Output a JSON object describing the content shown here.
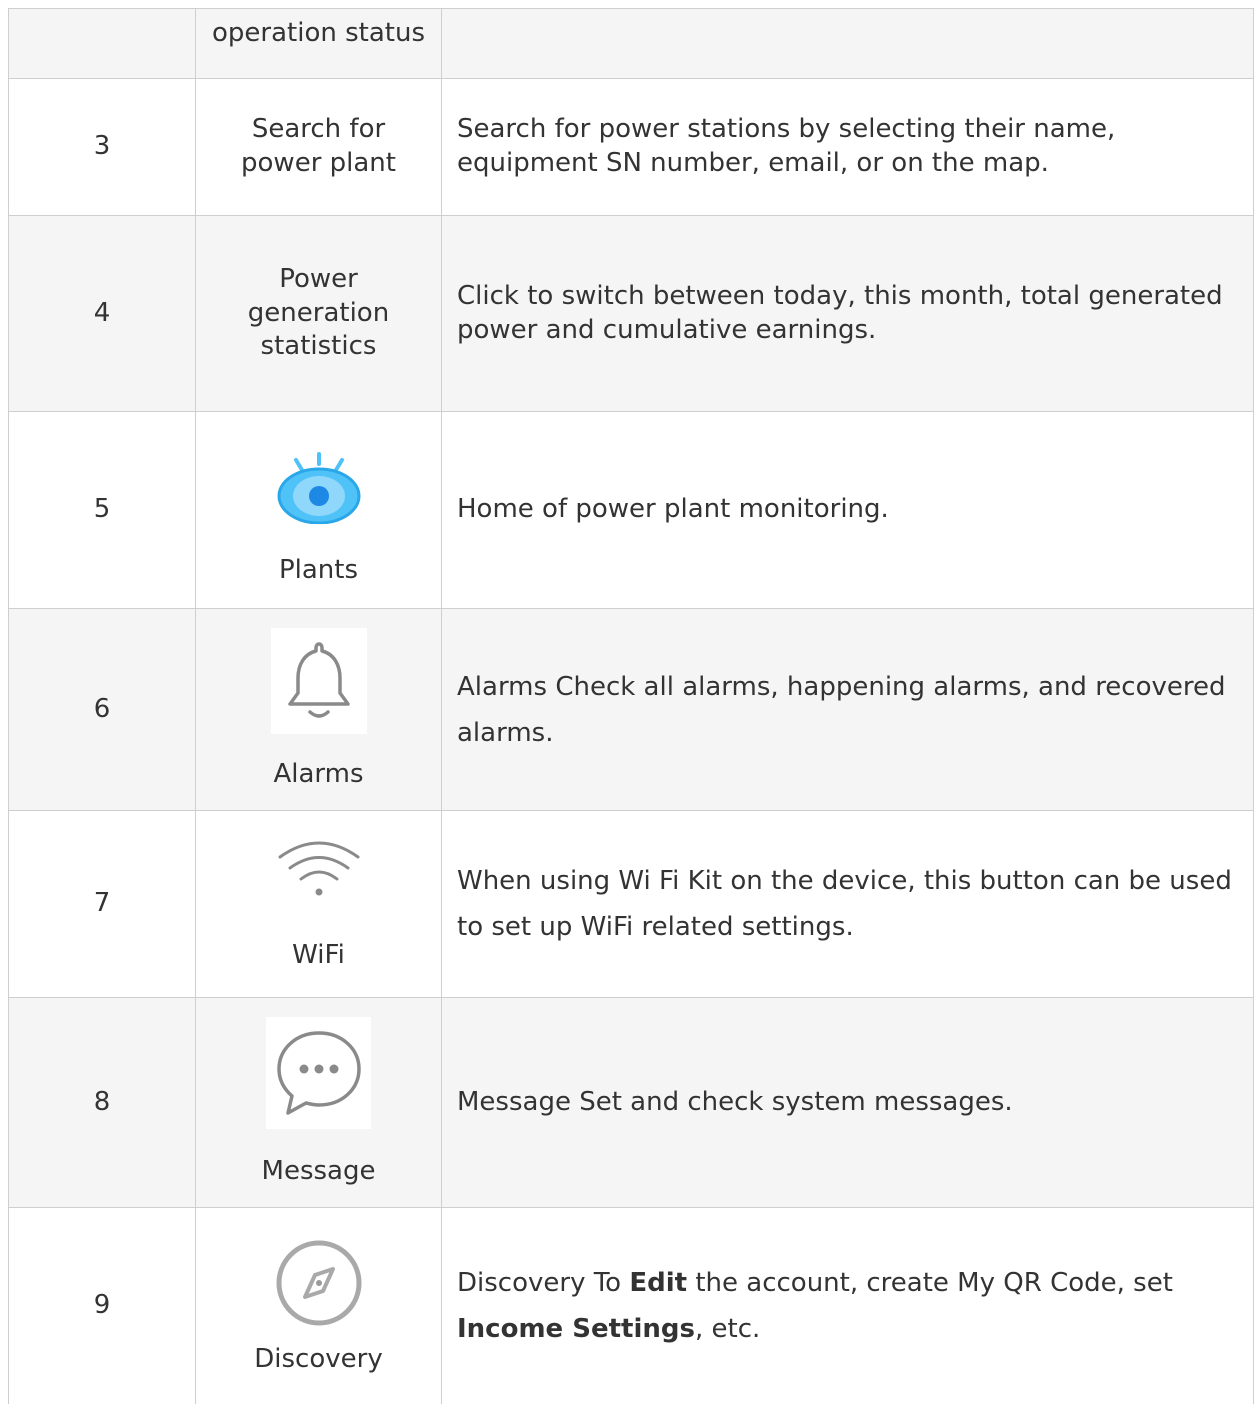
{
  "rows": [
    {
      "num": "",
      "name": "operation status",
      "desc": ""
    },
    {
      "num": "3",
      "name_lines": [
        "Search for",
        "power plant"
      ],
      "desc": "Search for power stations by selecting their name, equipment SN number, email, or on the map."
    },
    {
      "num": "4",
      "name_lines": [
        "Power",
        "generation",
        "statistics"
      ],
      "desc": "Click to switch between today, this month, total generated power and cumulative earnings."
    },
    {
      "num": "5",
      "icon": "eye-icon",
      "name": "Plants",
      "desc": "Home of power plant monitoring."
    },
    {
      "num": "6",
      "icon": "bell-icon",
      "name": "Alarms",
      "desc": "Alarms Check all alarms, happening alarms, and recovered alarms."
    },
    {
      "num": "7",
      "icon": "wifi-icon",
      "name": "WiFi",
      "desc": "When using Wi Fi Kit on the device, this button can be used to set up WiFi related settings."
    },
    {
      "num": "8",
      "icon": "chat-bubble-icon",
      "name": "Message",
      "desc": "Message Set and check system messages."
    },
    {
      "num": "9",
      "icon": "compass-icon",
      "name": "Discovery",
      "desc_parts": {
        "a": "Discovery To ",
        "b": "Edit",
        "c": " the account, create My QR Code, set ",
        "d": "Income Settings",
        "e": ", etc."
      }
    }
  ],
  "colors": {
    "shaded_row": "#f5f5f5",
    "border": "#cfcfcf",
    "plants_icon": "#4fc3f7",
    "plants_icon_center": "#1e88e5",
    "icon_gray": "#9e9e9e"
  }
}
